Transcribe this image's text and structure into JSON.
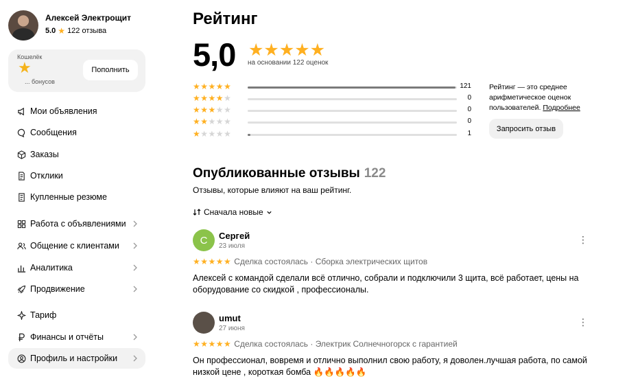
{
  "profile": {
    "name": "Алексей Электрощит",
    "score": "5.0",
    "reviews_count": "122 отзыва"
  },
  "wallet": {
    "title": "Кошелёк",
    "bonus": "... бонусов",
    "button": "Пополнить"
  },
  "nav": [
    {
      "label": "Мои объявления",
      "icon": "megaphone-icon",
      "chevron": false
    },
    {
      "label": "Сообщения",
      "icon": "chat-icon",
      "chevron": false
    },
    {
      "label": "Заказы",
      "icon": "box-icon",
      "chevron": false
    },
    {
      "label": "Отклики",
      "icon": "document-icon",
      "chevron": false
    },
    {
      "label": "Купленные резюме",
      "icon": "resume-icon",
      "chevron": false
    },
    {
      "label": "Работа с объявлениями",
      "icon": "grid-icon",
      "chevron": true
    },
    {
      "label": "Общение с клиентами",
      "icon": "people-icon",
      "chevron": true
    },
    {
      "label": "Аналитика",
      "icon": "chart-icon",
      "chevron": true
    },
    {
      "label": "Продвижение",
      "icon": "rocket-icon",
      "chevron": true
    },
    {
      "label": "Тариф",
      "icon": "sparkle-icon",
      "chevron": false
    },
    {
      "label": "Финансы и отчёты",
      "icon": "ruble-icon",
      "chevron": true
    },
    {
      "label": "Профиль и настройки",
      "icon": "user-icon",
      "chevron": true
    }
  ],
  "rating": {
    "title": "Рейтинг",
    "score": "5,0",
    "based_on": "на основании 122 оценок",
    "distribution": [
      {
        "stars": 5,
        "count": "121",
        "fraction": 0.992
      },
      {
        "stars": 4,
        "count": "0",
        "fraction": 0
      },
      {
        "stars": 3,
        "count": "0",
        "fraction": 0
      },
      {
        "stars": 2,
        "count": "0",
        "fraction": 0
      },
      {
        "stars": 1,
        "count": "1",
        "fraction": 0.012
      }
    ],
    "note": "Рейтинг — это среднее арифметическое оценок пользователей.",
    "note_link": "Подробнее",
    "request_button": "Запросить отзыв"
  },
  "published": {
    "title": "Опубликованные отзывы",
    "count": "122",
    "subtitle": "Отзывы, которые влияют на ваш рейтинг.",
    "sort_label": "Сначала новые"
  },
  "reviews": [
    {
      "author": "Сергей",
      "avatar_letter": "С",
      "avatar_color": "#8bc34a",
      "date": "23 июля",
      "stars": "★★★★★",
      "meta": "Сделка состоялась · Сборка электрических щитов",
      "text": "Алексей с командой сделали всё отлично, собрали и подключили 3 щита, всё работает, цены на оборудование со скидкой , профессионалы."
    },
    {
      "author": "umut",
      "avatar_letter": "",
      "avatar_color": "#5a5048",
      "date": "27 июня",
      "stars": "★★★★★",
      "meta": "Сделка состоялась · Электрик Солнечногорск с гарантией",
      "text": "Он профессионал, вовремя и отлично выполнил свою работу, я доволен.лучшая работа, по самой низкой цене , короткая бомба 🔥🔥🔥🔥🔥"
    }
  ],
  "colors": {
    "star": "#ffb021",
    "bar_fill": "#7a7a7a",
    "bar_bg": "#e0e0e0",
    "active_bg": "#f2f2f2"
  }
}
